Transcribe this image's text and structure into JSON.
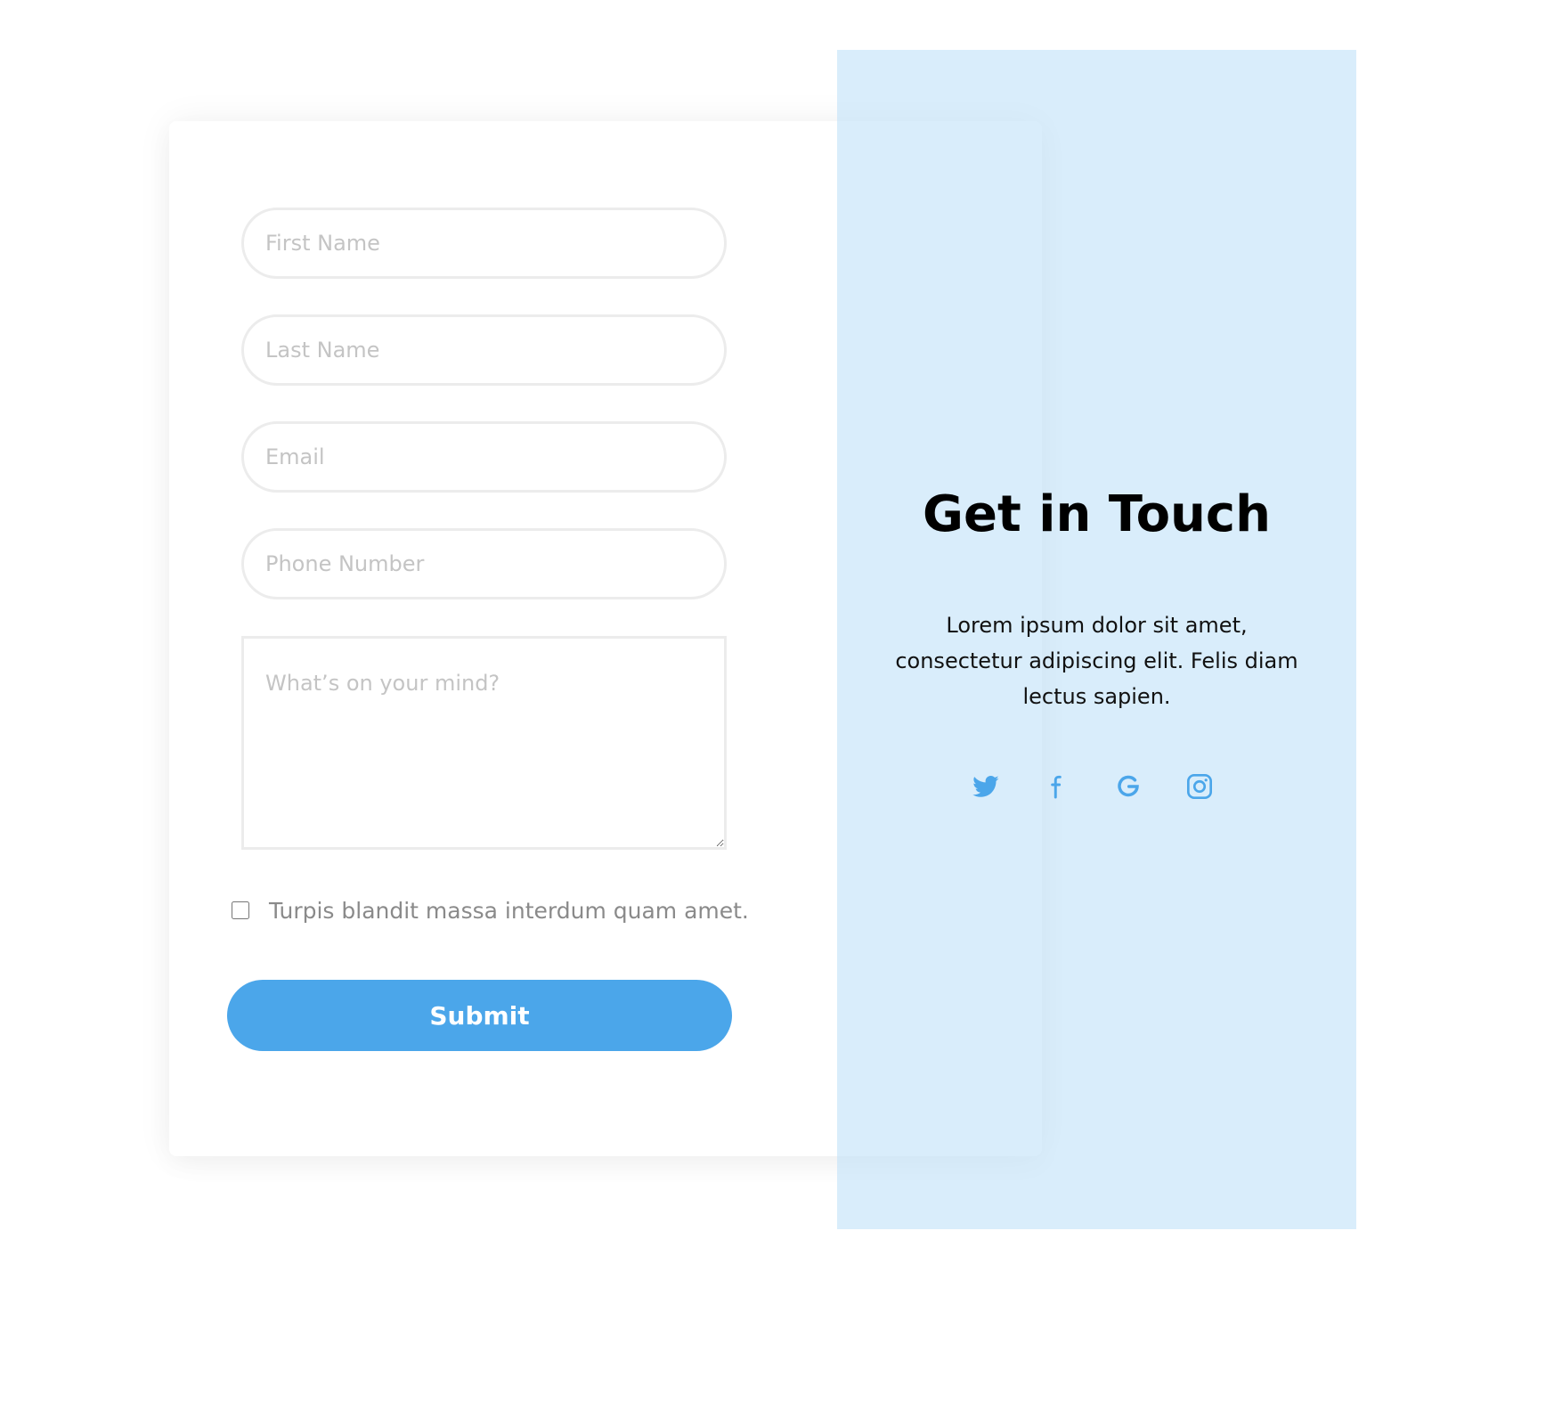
{
  "form": {
    "first_name_placeholder": "First Name",
    "last_name_placeholder": "Last Name",
    "email_placeholder": "Email",
    "phone_placeholder": "Phone Number",
    "message_placeholder": "What’s on your mind?",
    "consent_label": "Turpis blandit massa interdum quam amet.",
    "consent_checked": false,
    "submit_label": "Submit"
  },
  "panel": {
    "title": "Get in Touch",
    "text": "Lorem ipsum dolor sit amet, consectetur adipiscing elit. Felis diam lectus sapien.",
    "social_icons": [
      "twitter-icon",
      "facebook-icon",
      "google-icon",
      "instagram-icon"
    ]
  },
  "colors": {
    "accent": "#4ba6ea",
    "panel_background": "#d9eefb",
    "input_border": "#ececec",
    "placeholder": "#c4c4c4"
  }
}
